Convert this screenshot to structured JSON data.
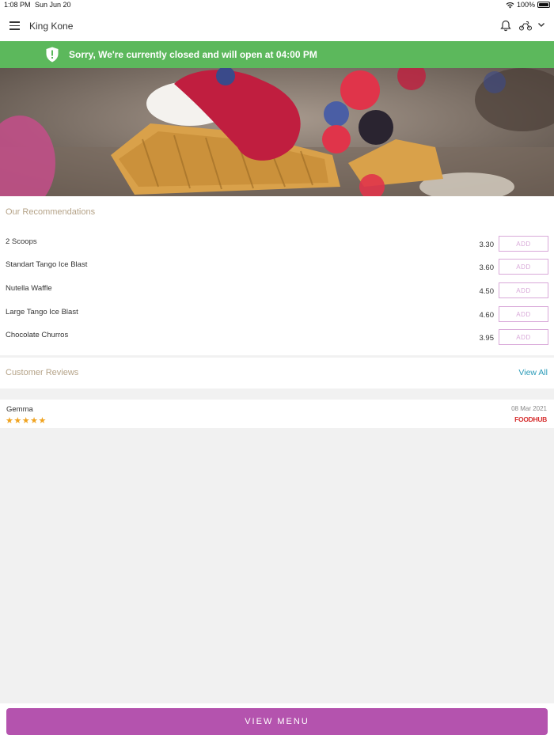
{
  "status_bar": {
    "time": "1:08 PM",
    "date": "Sun Jun 20",
    "battery": "100%"
  },
  "header": {
    "title": "King Kone"
  },
  "banner": {
    "message": "Sorry, We're currently closed and will open at 04:00 PM",
    "color": "#5cb85c"
  },
  "hero": {
    "image_icon": "food-waffle-image"
  },
  "recommendations": {
    "title": "Our Recommendations",
    "add_label": "ADD",
    "items": [
      {
        "name": "2 Scoops",
        "price": "3.30"
      },
      {
        "name": "Standart Tango Ice Blast",
        "price": "3.60"
      },
      {
        "name": "Nutella Waffle",
        "price": "4.50"
      },
      {
        "name": "Large Tango Ice Blast",
        "price": "4.60"
      },
      {
        "name": "Chocolate Churros",
        "price": "3.95"
      }
    ]
  },
  "reviews": {
    "title": "Customer Reviews",
    "view_all": "View All",
    "items": [
      {
        "reviewer": "Gemma",
        "rating": 5,
        "stars": "★★★★★",
        "date": "08 Mar 2021",
        "source": "FOODHUB"
      }
    ]
  },
  "footer": {
    "button_label": "VIEW MENU",
    "accent": "#b453ae"
  }
}
